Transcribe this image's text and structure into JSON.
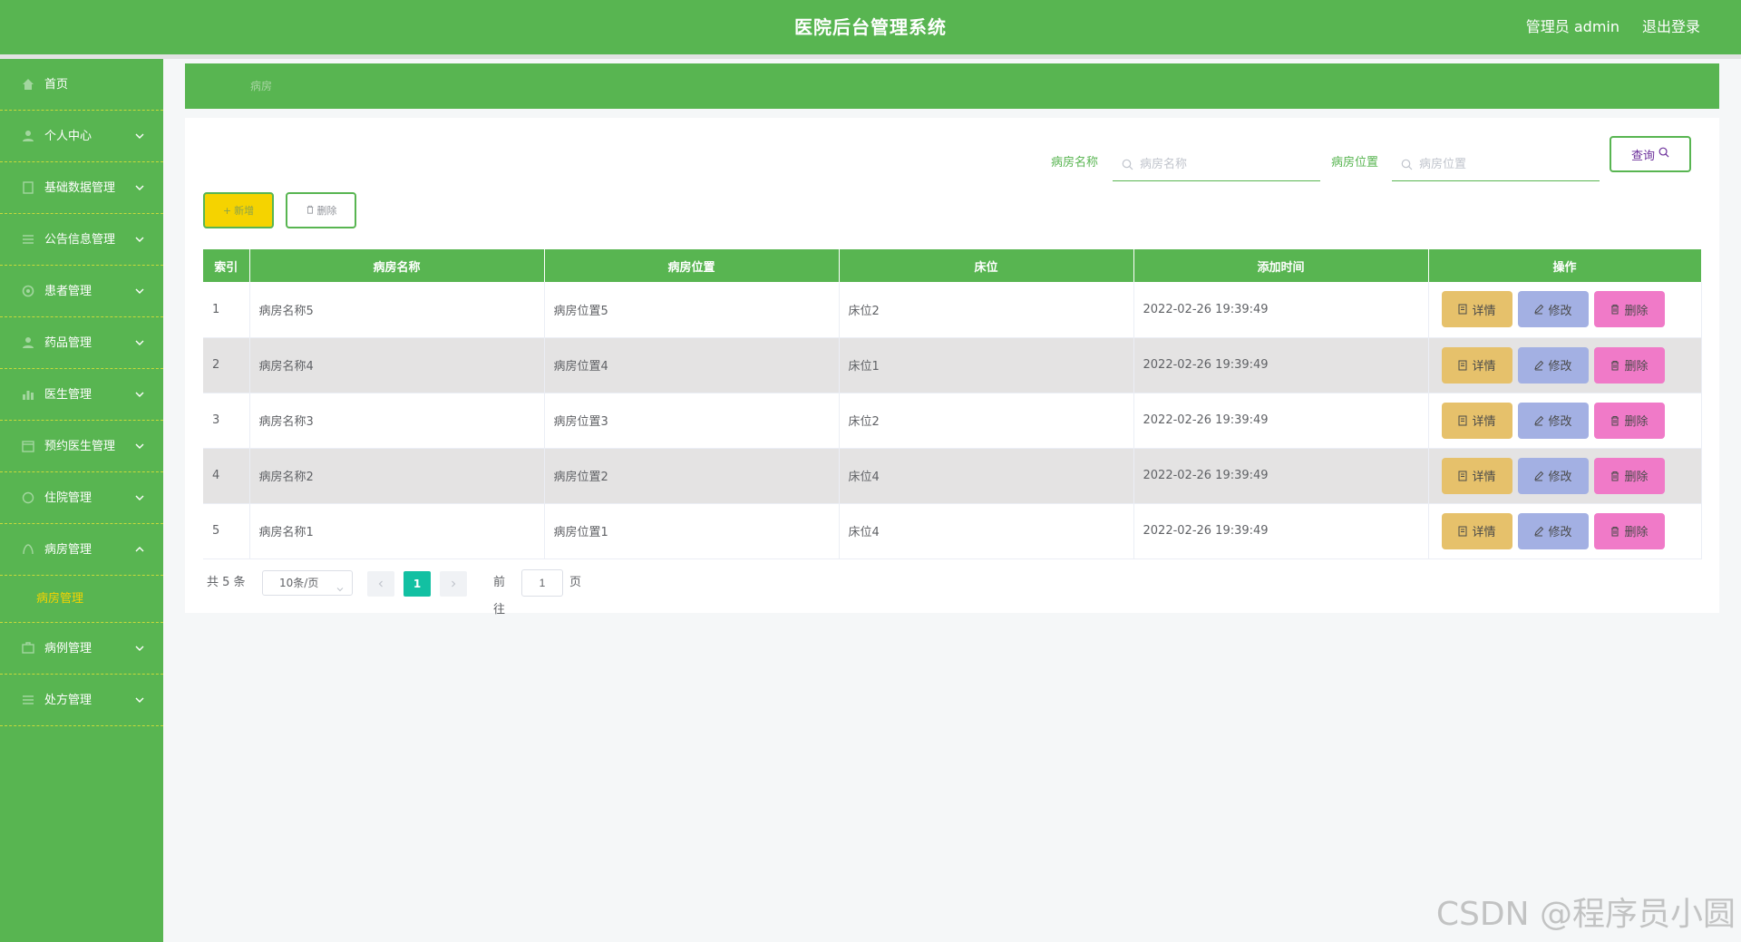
{
  "header": {
    "title": "医院后台管理系统",
    "user": "管理员 admin",
    "logout": "退出登录"
  },
  "sidebar": {
    "items": [
      {
        "label": "首页",
        "icon": "home-icon",
        "expandable": false
      },
      {
        "label": "个人中心",
        "icon": "user-icon",
        "expandable": true
      },
      {
        "label": "基础数据管理",
        "icon": "document-icon",
        "expandable": true
      },
      {
        "label": "公告信息管理",
        "icon": "list-icon",
        "expandable": true
      },
      {
        "label": "患者管理",
        "icon": "patient-icon",
        "expandable": true
      },
      {
        "label": "药品管理",
        "icon": "medicine-icon",
        "expandable": true
      },
      {
        "label": "医生管理",
        "icon": "chart-icon",
        "expandable": true
      },
      {
        "label": "预约医生管理",
        "icon": "calendar-icon",
        "expandable": true
      },
      {
        "label": "住院管理",
        "icon": "circle-icon",
        "expandable": true
      },
      {
        "label": "病房管理",
        "icon": "room-icon",
        "expandable": true,
        "expanded": true
      },
      {
        "label": "病例管理",
        "icon": "case-icon",
        "expandable": true
      },
      {
        "label": "处方管理",
        "icon": "prescription-icon",
        "expandable": true
      }
    ],
    "active_submenu": "病房管理"
  },
  "breadcrumb": {
    "current": "病房"
  },
  "search": {
    "name_label": "病房名称",
    "name_placeholder": "病房名称",
    "location_label": "病房位置",
    "location_placeholder": "病房位置",
    "query_label": "查询"
  },
  "actions": {
    "add_label": "新增",
    "delete_label": "删除"
  },
  "table": {
    "headers": [
      "索引",
      "病房名称",
      "病房位置",
      "床位",
      "添加时间",
      "操作"
    ],
    "rows": [
      {
        "index": "1",
        "name": "病房名称5",
        "location": "病房位置5",
        "bed": "床位2",
        "time": "2022-02-26 19:39:49"
      },
      {
        "index": "2",
        "name": "病房名称4",
        "location": "病房位置4",
        "bed": "床位1",
        "time": "2022-02-26 19:39:49"
      },
      {
        "index": "3",
        "name": "病房名称3",
        "location": "病房位置3",
        "bed": "床位2",
        "time": "2022-02-26 19:39:49"
      },
      {
        "index": "4",
        "name": "病房名称2",
        "location": "病房位置2",
        "bed": "床位4",
        "time": "2022-02-26 19:39:49"
      },
      {
        "index": "5",
        "name": "病房名称1",
        "location": "病房位置1",
        "bed": "床位4",
        "time": "2022-02-26 19:39:49"
      }
    ],
    "op_detail": "详情",
    "op_edit": "修改",
    "op_delete": "删除"
  },
  "pagination": {
    "total": "共 5 条",
    "page_size": "10条/页",
    "current_page": "1",
    "goto_label": "前往",
    "goto_value": "1",
    "goto_unit": "页"
  },
  "watermark": "CSDN @程序员小圆",
  "colors": {
    "primary": "#58b551",
    "accent": "#f5d300",
    "detail": "#e6c16b",
    "edit": "#a3b0e3",
    "delete": "#f07ac8",
    "page_active": "#12c0a2"
  }
}
